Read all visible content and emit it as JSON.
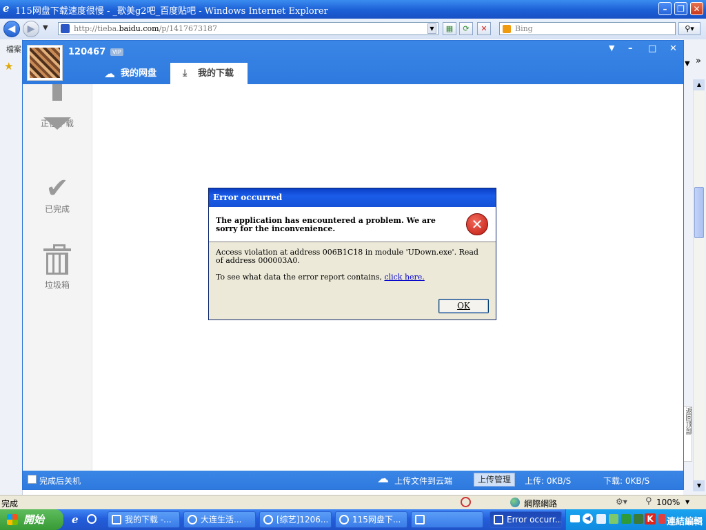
{
  "ie": {
    "title": "115网盘下载速度很慢 - _歌美g2吧_百度贴吧 - Windows Internet Explorer",
    "address_prefix": "http://tieba.",
    "address_domain": "baidu.com",
    "address_path": "/p/1417673187",
    "search_placeholder": "Bing",
    "menu_fragment": "檔案",
    "status_text": "完成",
    "zone": "網際網路",
    "zoom": "100%"
  },
  "app": {
    "username": "120467",
    "vip": "VIP",
    "tabs": [
      {
        "label": "我的网盘"
      },
      {
        "label": "我的下载"
      }
    ],
    "sidebar": [
      {
        "label": "正在下载"
      },
      {
        "label": "已完成"
      },
      {
        "label": "垃圾箱"
      }
    ],
    "bottom": {
      "shutdown_label": "完成后关机",
      "upload_cloud": "上传文件到云端",
      "upload_mgmt": "上传管理",
      "upload_speed": "上传: 0KB/S",
      "download_speed": "下载: 0KB/S"
    },
    "right_strip_text": "返回顶部"
  },
  "dialog": {
    "title": "Error occurred",
    "headline": "The application has encountered a problem. We are sorry for the inconvenience.",
    "detail": "Access violation at address 006B1C18 in module 'UDown.exe'. Read of address 000003A0.",
    "report_prefix": "To see what data the error report contains, ",
    "report_link": "click here.",
    "ok_label": "OK"
  },
  "taskbar": {
    "start_label": "開始",
    "tasks": [
      {
        "label": "我的下载 -..."
      },
      {
        "label": "大连生活..."
      },
      {
        "label": "[综艺]1206..."
      },
      {
        "label": "115网盘下..."
      },
      {
        "label": ""
      },
      {
        "label": "Error occurr..."
      }
    ],
    "tray_text": "連結編輯"
  },
  "colors": {
    "xp_blue": "#245edb",
    "app_blue": "#2e79de",
    "error_red": "#c01a10"
  }
}
